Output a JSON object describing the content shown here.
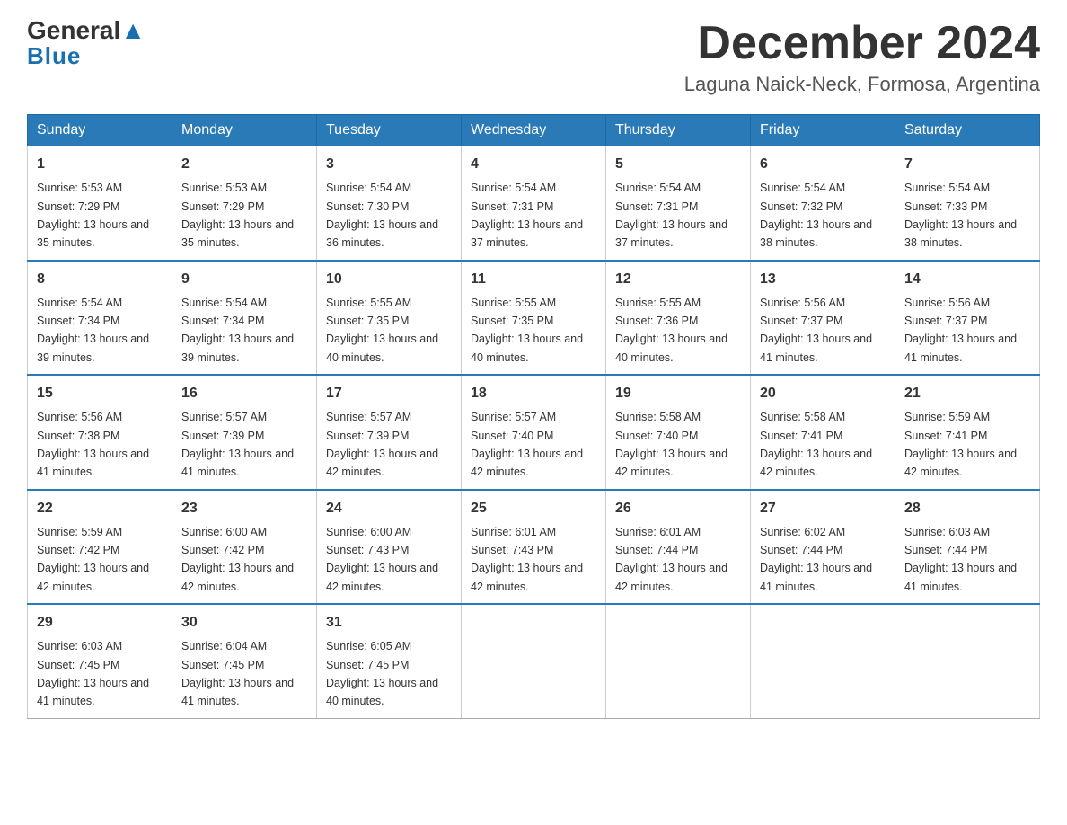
{
  "header": {
    "logo": {
      "general": "General",
      "blue": "Blue"
    },
    "title": "December 2024",
    "location": "Laguna Naick-Neck, Formosa, Argentina"
  },
  "weekdays": [
    "Sunday",
    "Monday",
    "Tuesday",
    "Wednesday",
    "Thursday",
    "Friday",
    "Saturday"
  ],
  "weeks": [
    [
      {
        "day": "1",
        "sunrise": "5:53 AM",
        "sunset": "7:29 PM",
        "daylight": "13 hours and 35 minutes."
      },
      {
        "day": "2",
        "sunrise": "5:53 AM",
        "sunset": "7:29 PM",
        "daylight": "13 hours and 35 minutes."
      },
      {
        "day": "3",
        "sunrise": "5:54 AM",
        "sunset": "7:30 PM",
        "daylight": "13 hours and 36 minutes."
      },
      {
        "day": "4",
        "sunrise": "5:54 AM",
        "sunset": "7:31 PM",
        "daylight": "13 hours and 37 minutes."
      },
      {
        "day": "5",
        "sunrise": "5:54 AM",
        "sunset": "7:31 PM",
        "daylight": "13 hours and 37 minutes."
      },
      {
        "day": "6",
        "sunrise": "5:54 AM",
        "sunset": "7:32 PM",
        "daylight": "13 hours and 38 minutes."
      },
      {
        "day": "7",
        "sunrise": "5:54 AM",
        "sunset": "7:33 PM",
        "daylight": "13 hours and 38 minutes."
      }
    ],
    [
      {
        "day": "8",
        "sunrise": "5:54 AM",
        "sunset": "7:34 PM",
        "daylight": "13 hours and 39 minutes."
      },
      {
        "day": "9",
        "sunrise": "5:54 AM",
        "sunset": "7:34 PM",
        "daylight": "13 hours and 39 minutes."
      },
      {
        "day": "10",
        "sunrise": "5:55 AM",
        "sunset": "7:35 PM",
        "daylight": "13 hours and 40 minutes."
      },
      {
        "day": "11",
        "sunrise": "5:55 AM",
        "sunset": "7:35 PM",
        "daylight": "13 hours and 40 minutes."
      },
      {
        "day": "12",
        "sunrise": "5:55 AM",
        "sunset": "7:36 PM",
        "daylight": "13 hours and 40 minutes."
      },
      {
        "day": "13",
        "sunrise": "5:56 AM",
        "sunset": "7:37 PM",
        "daylight": "13 hours and 41 minutes."
      },
      {
        "day": "14",
        "sunrise": "5:56 AM",
        "sunset": "7:37 PM",
        "daylight": "13 hours and 41 minutes."
      }
    ],
    [
      {
        "day": "15",
        "sunrise": "5:56 AM",
        "sunset": "7:38 PM",
        "daylight": "13 hours and 41 minutes."
      },
      {
        "day": "16",
        "sunrise": "5:57 AM",
        "sunset": "7:39 PM",
        "daylight": "13 hours and 41 minutes."
      },
      {
        "day": "17",
        "sunrise": "5:57 AM",
        "sunset": "7:39 PM",
        "daylight": "13 hours and 42 minutes."
      },
      {
        "day": "18",
        "sunrise": "5:57 AM",
        "sunset": "7:40 PM",
        "daylight": "13 hours and 42 minutes."
      },
      {
        "day": "19",
        "sunrise": "5:58 AM",
        "sunset": "7:40 PM",
        "daylight": "13 hours and 42 minutes."
      },
      {
        "day": "20",
        "sunrise": "5:58 AM",
        "sunset": "7:41 PM",
        "daylight": "13 hours and 42 minutes."
      },
      {
        "day": "21",
        "sunrise": "5:59 AM",
        "sunset": "7:41 PM",
        "daylight": "13 hours and 42 minutes."
      }
    ],
    [
      {
        "day": "22",
        "sunrise": "5:59 AM",
        "sunset": "7:42 PM",
        "daylight": "13 hours and 42 minutes."
      },
      {
        "day": "23",
        "sunrise": "6:00 AM",
        "sunset": "7:42 PM",
        "daylight": "13 hours and 42 minutes."
      },
      {
        "day": "24",
        "sunrise": "6:00 AM",
        "sunset": "7:43 PM",
        "daylight": "13 hours and 42 minutes."
      },
      {
        "day": "25",
        "sunrise": "6:01 AM",
        "sunset": "7:43 PM",
        "daylight": "13 hours and 42 minutes."
      },
      {
        "day": "26",
        "sunrise": "6:01 AM",
        "sunset": "7:44 PM",
        "daylight": "13 hours and 42 minutes."
      },
      {
        "day": "27",
        "sunrise": "6:02 AM",
        "sunset": "7:44 PM",
        "daylight": "13 hours and 41 minutes."
      },
      {
        "day": "28",
        "sunrise": "6:03 AM",
        "sunset": "7:44 PM",
        "daylight": "13 hours and 41 minutes."
      }
    ],
    [
      {
        "day": "29",
        "sunrise": "6:03 AM",
        "sunset": "7:45 PM",
        "daylight": "13 hours and 41 minutes."
      },
      {
        "day": "30",
        "sunrise": "6:04 AM",
        "sunset": "7:45 PM",
        "daylight": "13 hours and 41 minutes."
      },
      {
        "day": "31",
        "sunrise": "6:05 AM",
        "sunset": "7:45 PM",
        "daylight": "13 hours and 40 minutes."
      },
      null,
      null,
      null,
      null
    ]
  ]
}
